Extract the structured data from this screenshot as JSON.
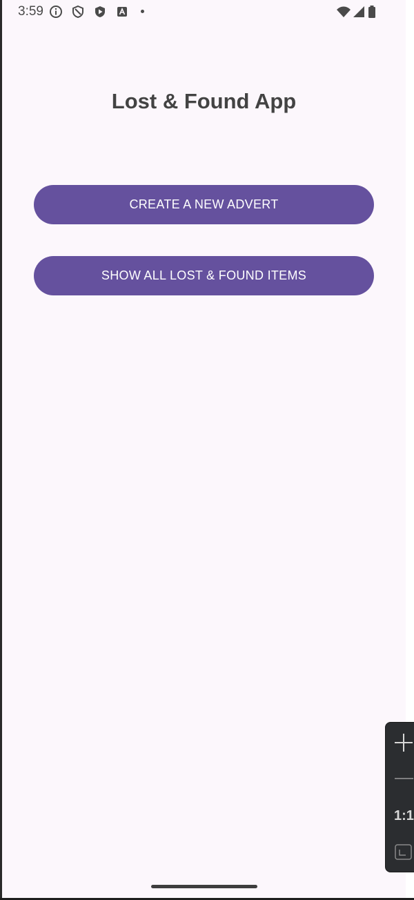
{
  "status_bar": {
    "time": "3:59",
    "left_icons": [
      "info-icon",
      "shield-outline-icon",
      "shield-play-icon",
      "text-a-icon",
      "dot-icon"
    ],
    "right_icons": [
      "wifi-icon",
      "cellular-signal-icon",
      "battery-icon"
    ]
  },
  "app": {
    "title": "Lost & Found App"
  },
  "actions": {
    "create_label": "CREATE A NEW ADVERT",
    "show_label": "SHOW ALL LOST & FOUND ITEMS"
  },
  "zoom_panel": {
    "reset_label": "1:1",
    "icons": [
      "plus-icon",
      "minus-icon",
      "fit-screen-icon"
    ]
  },
  "colors": {
    "background": "#fcf7fc",
    "button": "#65519e",
    "button_text": "#ffffff",
    "title_text": "#434343"
  }
}
